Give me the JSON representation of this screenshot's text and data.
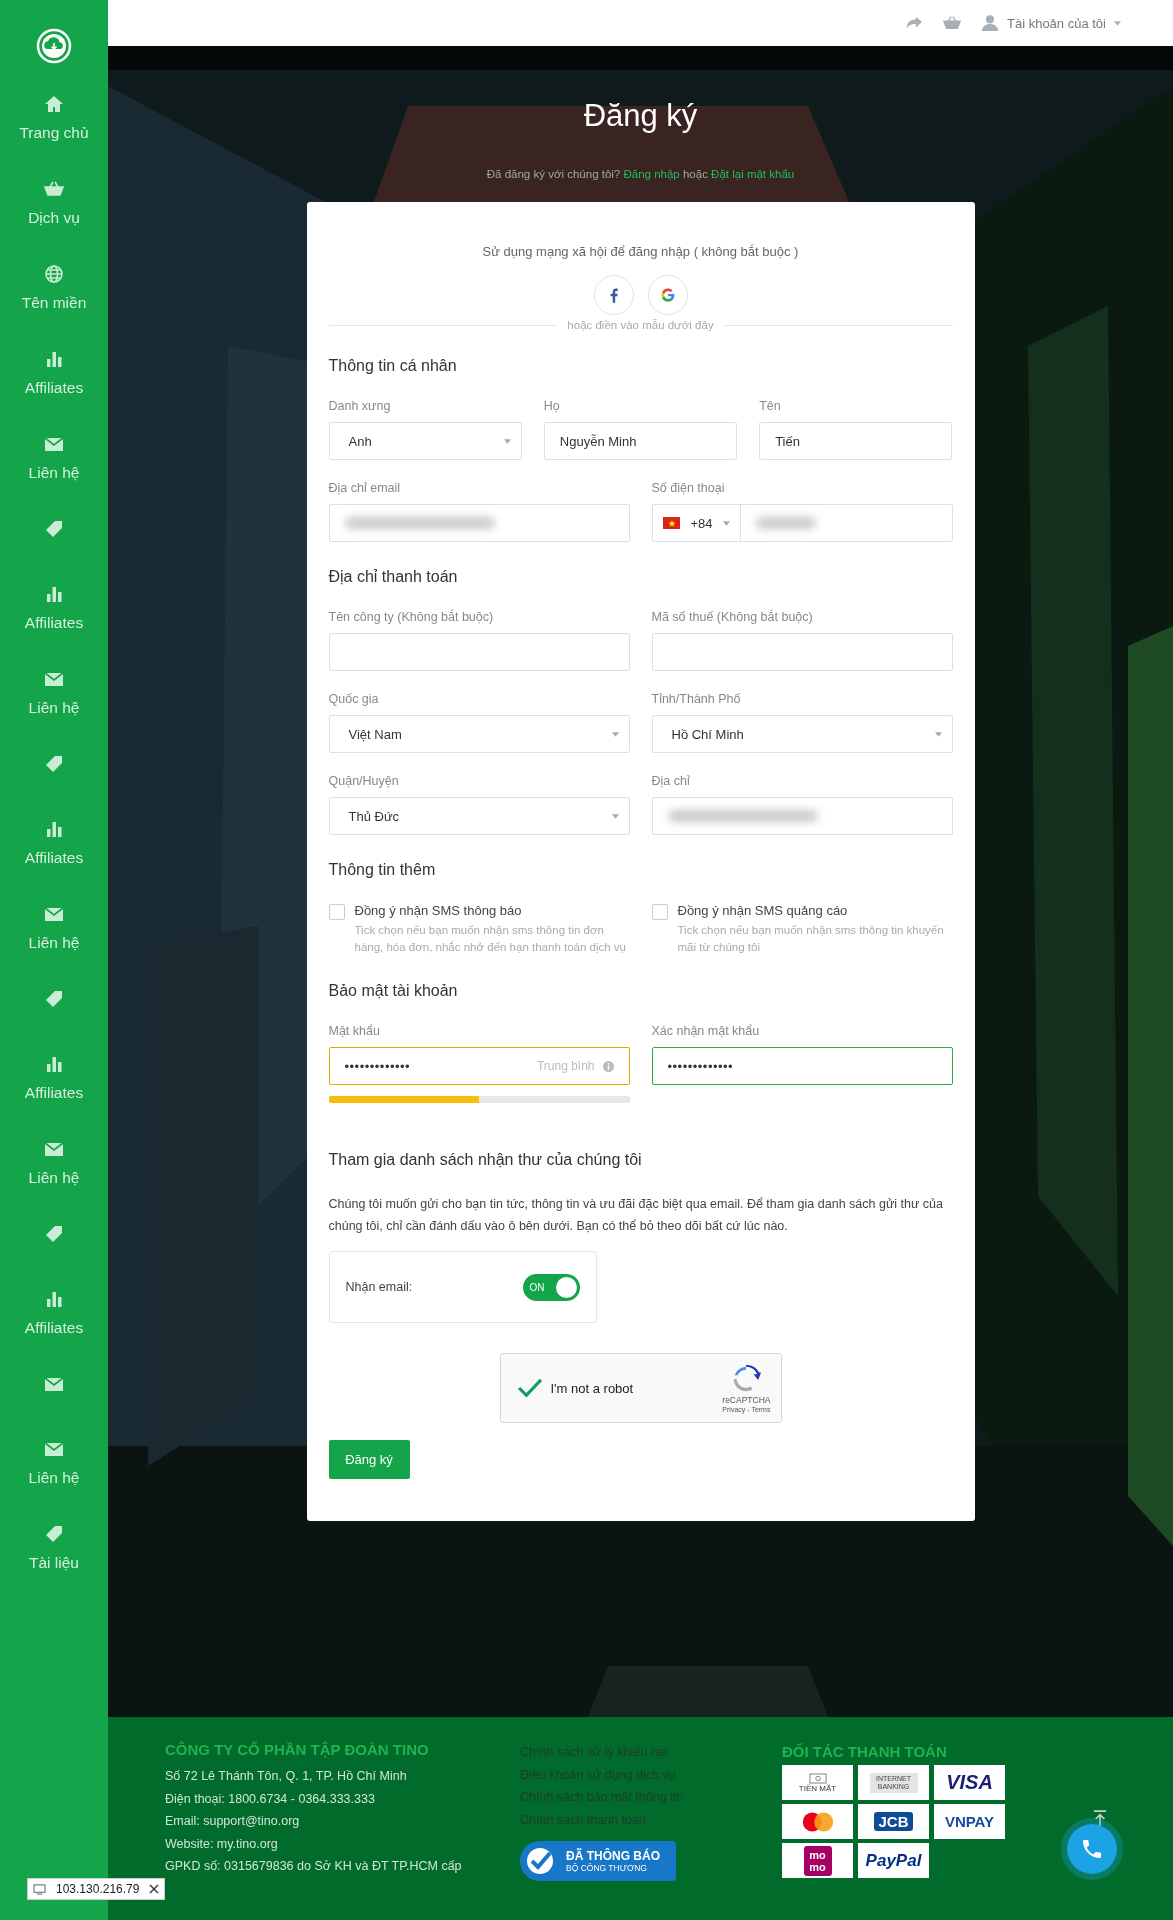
{
  "sidebar": {
    "items": [
      {
        "kind": "home",
        "label": "Trang chủ"
      },
      {
        "kind": "basket",
        "label": "Dịch vụ"
      },
      {
        "kind": "globe",
        "label": "Tên miền"
      },
      {
        "kind": "chart",
        "label": "Affiliates"
      },
      {
        "kind": "mail",
        "label": "Liên hệ"
      },
      {
        "kind": "tag"
      },
      {
        "kind": "chart",
        "label": "Affiliates"
      },
      {
        "kind": "mail",
        "label": "Liên hệ"
      },
      {
        "kind": "tag"
      },
      {
        "kind": "chart",
        "label": "Affiliates"
      },
      {
        "kind": "mail",
        "label": "Liên hệ"
      },
      {
        "kind": "tag"
      },
      {
        "kind": "chart",
        "label": "Affiliates"
      },
      {
        "kind": "mail",
        "label": "Liên hệ"
      },
      {
        "kind": "tag"
      },
      {
        "kind": "chart",
        "label": "Affiliates"
      },
      {
        "kind": "mail"
      },
      {
        "kind": "mail",
        "label": "Liên hệ"
      },
      {
        "kind": "tag",
        "label": "Tài liệu"
      }
    ]
  },
  "header": {
    "account": "Tài khoản của tôi"
  },
  "page": {
    "title": "Đăng ký",
    "prompt": "Đã đăng ký với chúng tôi?",
    "login_link": "Đăng nhập",
    "or": "hoặc",
    "reset_link": "Đặt lại mật khẩu"
  },
  "social": {
    "text": "Sử dụng mạng xã hội để đăng nhập ( không bắt buộc )",
    "divider": "hoặc điền vào mẫu dưới đây"
  },
  "personal": {
    "heading": "Thông tin cá nhân",
    "salutation": {
      "label": "Danh xưng",
      "value": "Anh"
    },
    "last_name": {
      "label": "Họ",
      "value": "Nguyễn Minh"
    },
    "first_name": {
      "label": "Tên",
      "value": "Tiến"
    },
    "email": {
      "label": "Địa chỉ email"
    },
    "phone": {
      "label": "Số điện thoại",
      "code": "+84"
    }
  },
  "billing": {
    "heading": "Địa chỉ thanh toán",
    "company": {
      "label": "Tên công ty (Không bắt buộc)"
    },
    "tax": {
      "label": "Mã số thuế (Không bắt buộc)"
    },
    "country": {
      "label": "Quốc gia",
      "value": "Việt Nam"
    },
    "city": {
      "label": "Tỉnh/Thành Phố",
      "value": "Hồ Chí Minh"
    },
    "district": {
      "label": "Quận/Huyện",
      "value": "Thủ Đức"
    },
    "address": {
      "label": "Địa chỉ"
    }
  },
  "extra": {
    "heading": "Thông tin thêm",
    "options": [
      {
        "label": "Đồng ý nhận SMS thông báo",
        "hint": "Tick chọn nếu bạn muốn nhận sms thông tin đơn hàng, hóa đơn, nhắc nhở đến hạn thanh toán dịch vụ",
        "checked": false
      },
      {
        "label": "Đồng ý nhận SMS quảng cáo",
        "hint": "Tick chọn nếu bạn muốn nhận sms thông tin khuyến mãi từ chúng tôi",
        "checked": false
      }
    ]
  },
  "security": {
    "heading": "Bảo mật tài khoản",
    "password": {
      "label": "Mật khẩu",
      "value": "•••••••••••••",
      "strength": "Trung bình",
      "level": 0.5
    },
    "confirm": {
      "label": "Xác nhận mật khẩu",
      "value": "•••••••••••••",
      "matched": true
    }
  },
  "newsletter": {
    "heading": "Tham gia danh sách nhận thư của chúng tôi",
    "text": "Chúng tôi muốn gửi cho bạn tin tức, thông tin và ưu đãi đặc biệt qua email. Để tham gia danh sách gửi thư của chúng tôi, chỉ cần đánh dấu vào ô bên dưới. Bạn có thể bỏ theo dõi bất cứ lúc nào.",
    "toggle": {
      "label": "Nhận email:",
      "state_text": "ON",
      "on": true
    }
  },
  "captcha": {
    "label": "I'm not a robot",
    "checked": true,
    "brand": "reCAPTCHA",
    "links": "Privacy - Terms"
  },
  "submit": "Đăng ký",
  "footer": {
    "company": {
      "name": "CÔNG TY CỔ PHẦN TẬP ĐOÀN TINO",
      "lines": [
        "Số 72 Lê Thánh Tôn, Q. 1, TP. Hồ Chí Minh",
        "Điện thoại: 1800.6734 - 0364.333.333",
        "Email: support@tino.org",
        "Website: my.tino.org",
        "GPKD số: 0315679836 do Sở KH và ĐT TP.HCM cấp"
      ]
    },
    "links": [
      "Chính sách xử lý khiếu nại",
      "Điều khoản sử dụng dịch vụ",
      "Chính sách bảo mật thông tin",
      "Chính sách thanh toán"
    ],
    "badge": {
      "title": "ĐÃ THÔNG BÁO",
      "subtitle": "BỘ CÔNG THƯƠNG"
    },
    "payments": {
      "heading": "ĐỐI TÁC THANH TOÁN",
      "items": [
        {
          "kind": "cash",
          "text": "TIỀN MẶT"
        },
        {
          "kind": "banking",
          "text": "INTERNET BANKING"
        },
        {
          "kind": "visa",
          "text": "VISA"
        },
        {
          "kind": "mastercard"
        },
        {
          "kind": "jcb",
          "text": "JCB"
        },
        {
          "kind": "vnpay",
          "text": "VNPAY"
        },
        {
          "kind": "momo",
          "text": "mo mo"
        },
        {
          "kind": "paypal",
          "text": "PayPal"
        }
      ]
    }
  },
  "ip_badge": "103.130.216.79"
}
